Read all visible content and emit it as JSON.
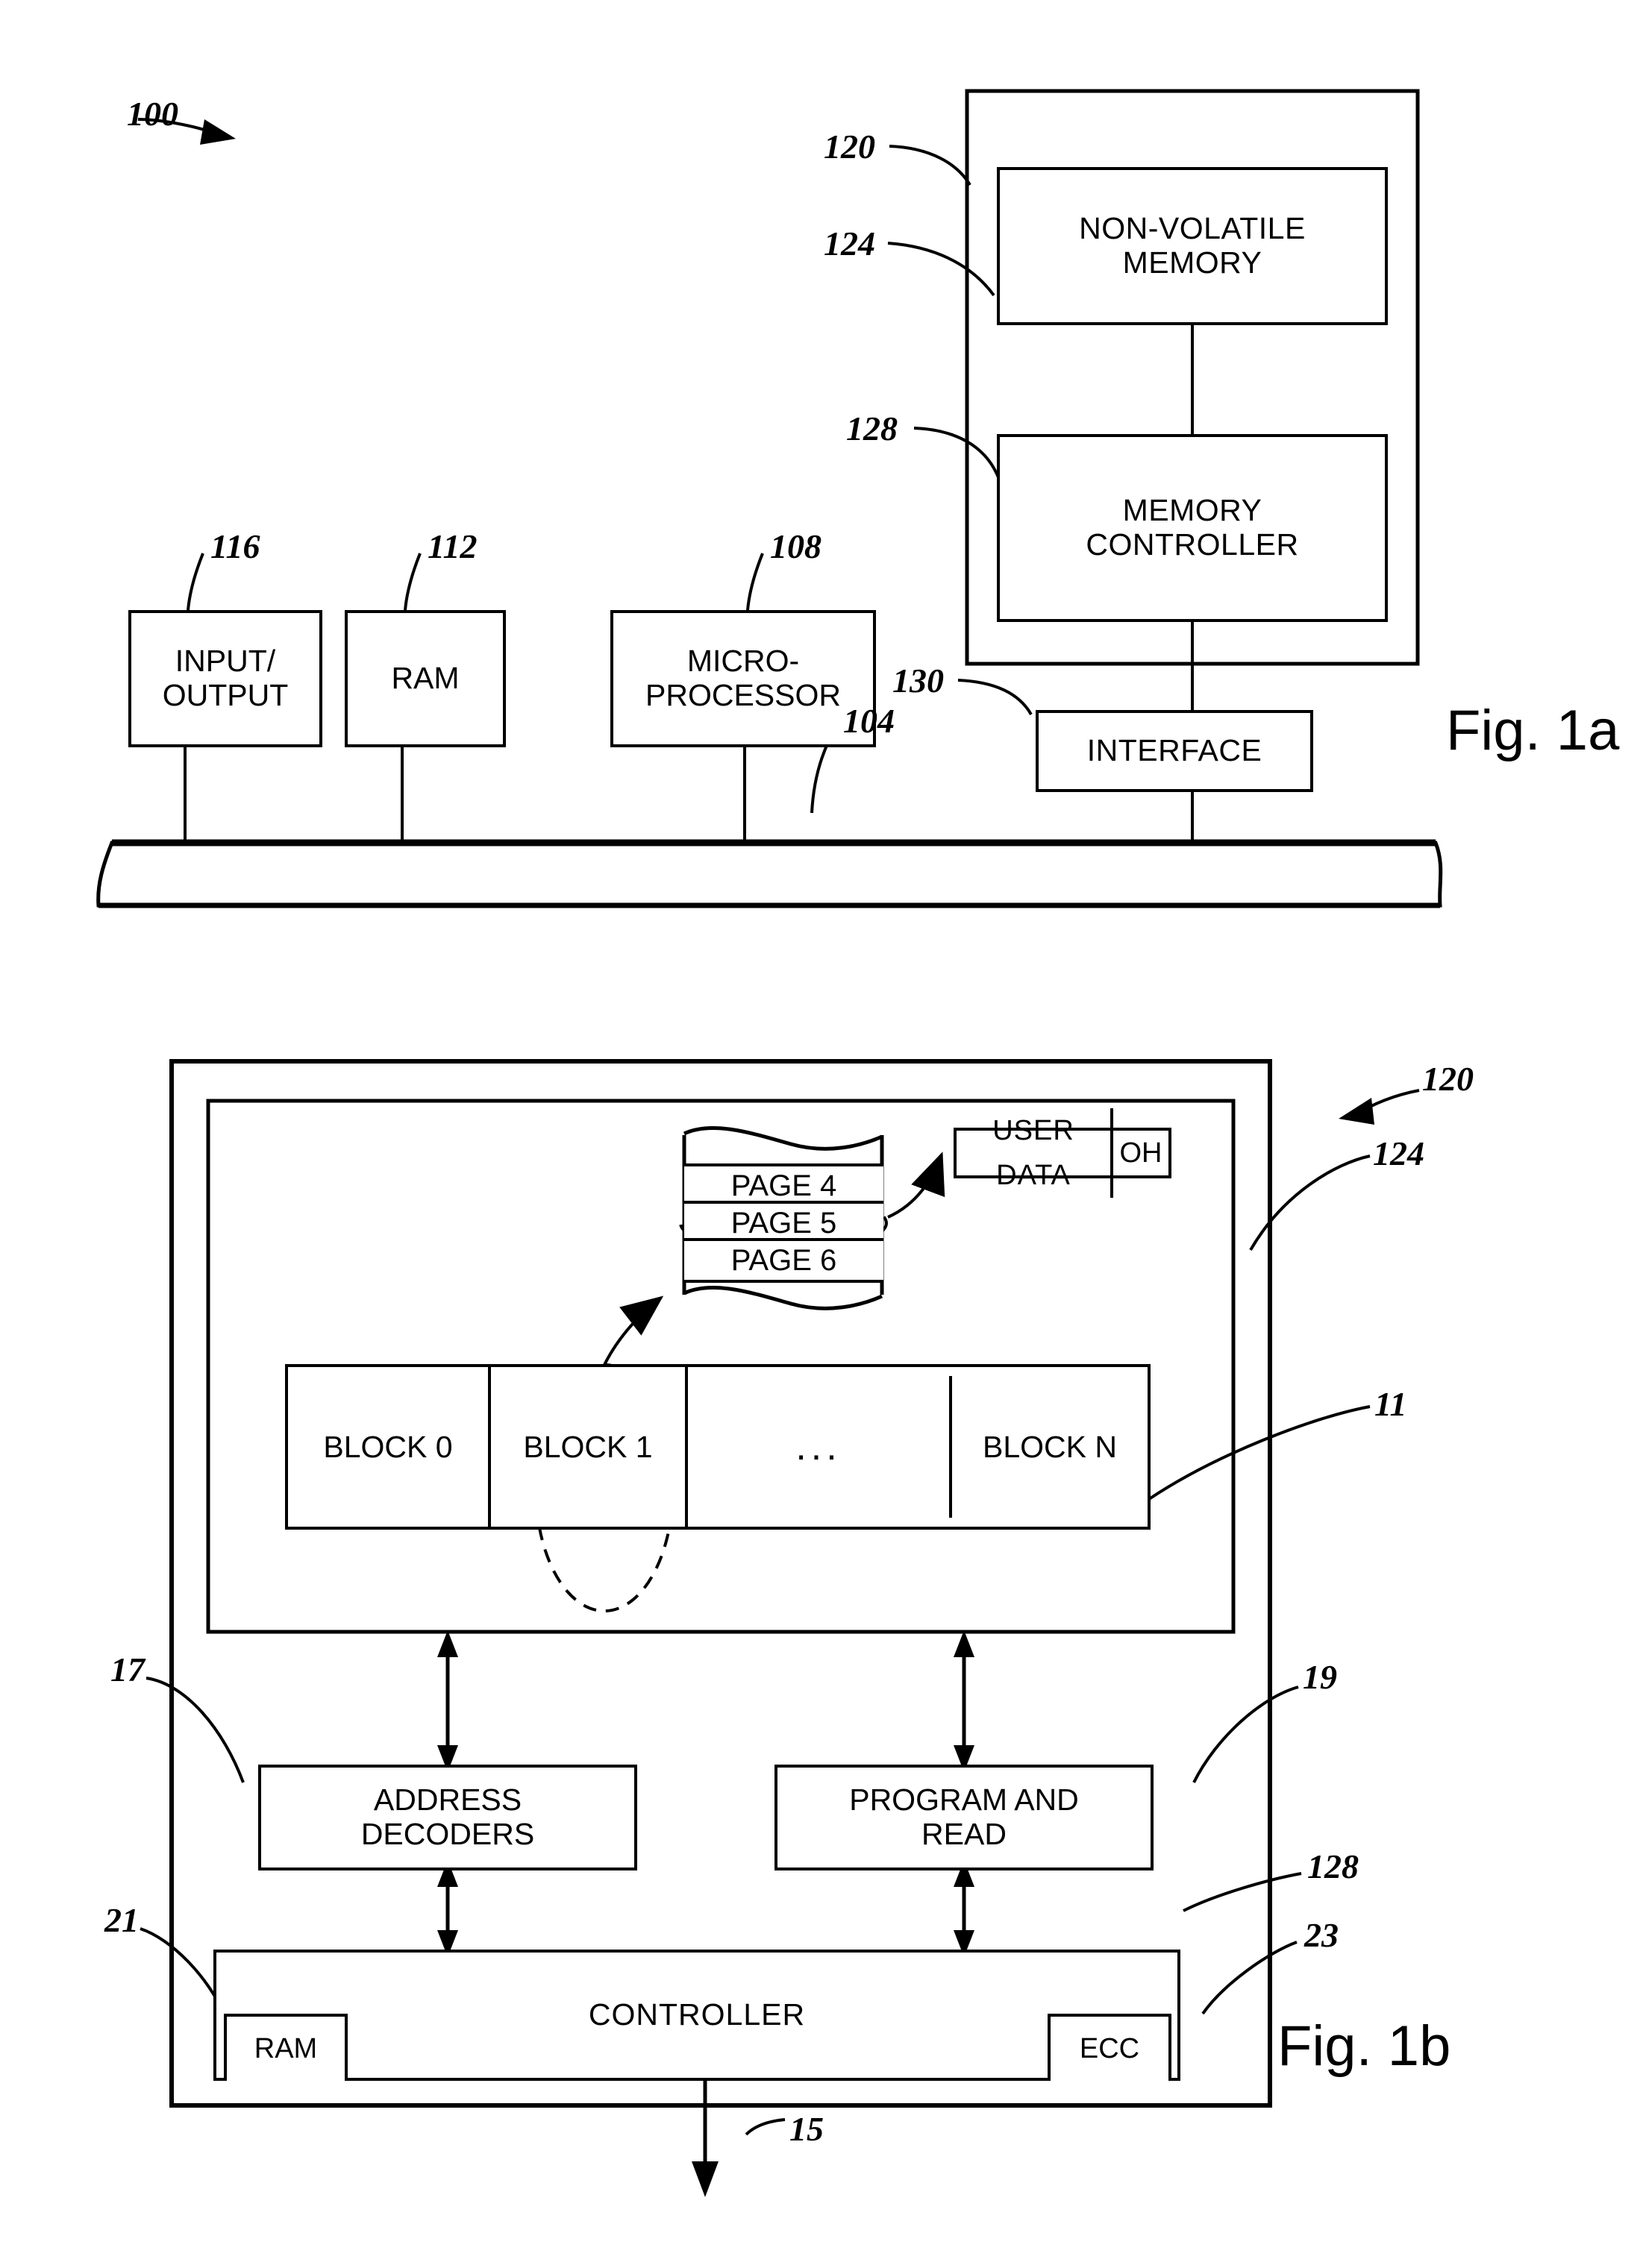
{
  "figures": [
    {
      "id": "fig-1a",
      "caption": "Fig. 1a",
      "system_ref": "100",
      "bus_ref": "104",
      "outer_module_ref": "120",
      "boxes": [
        {
          "name": "non-volatile-memory",
          "label": "NON-VOLATILE\nMEMORY",
          "ref": "124"
        },
        {
          "name": "memory-controller",
          "label": "MEMORY\nCONTROLLER",
          "ref": "128"
        },
        {
          "name": "interface",
          "label": "INTERFACE",
          "ref": "130"
        },
        {
          "name": "input-output",
          "label": "INPUT/\nOUTPUT",
          "ref": "116"
        },
        {
          "name": "ram",
          "label": "RAM",
          "ref": "112"
        },
        {
          "name": "microprocessor",
          "label": "MICRO-\nPROCESSOR",
          "ref": "108"
        }
      ]
    },
    {
      "id": "fig-1b",
      "caption": "Fig. 1b",
      "device_ref": "120",
      "array_ref": "124",
      "blocks_ref": "11",
      "address_decoders_ref": "17",
      "program_read_ref": "19",
      "controller_ref": "128",
      "controller_ram_ref": "21",
      "controller_ecc_ref": "23",
      "host_bus_ref": "15",
      "pages": [
        "PAGE 4",
        "PAGE 5",
        "PAGE 6"
      ],
      "page_detail": {
        "user_data": "USER  DATA",
        "overhead": "OH"
      },
      "blocks": [
        "BLOCK 0",
        "BLOCK 1",
        "...",
        "BLOCK N"
      ],
      "boxes": [
        {
          "name": "address-decoders",
          "label": "ADDRESS\nDECODERS"
        },
        {
          "name": "program-and-read",
          "label": "PROGRAM AND\nREAD"
        },
        {
          "name": "controller",
          "label": "CONTROLLER"
        },
        {
          "name": "controller-ram",
          "label": "RAM"
        },
        {
          "name": "controller-ecc",
          "label": "ECC"
        }
      ]
    }
  ],
  "fig1a": {
    "caption": "Fig. 1a",
    "ref_100": "100",
    "ref_104": "104",
    "ref_108": "108",
    "ref_112": "112",
    "ref_116": "116",
    "ref_120": "120",
    "ref_124": "124",
    "ref_128": "128",
    "ref_130": "130",
    "nvm_label": "NON-VOLATILE\nMEMORY",
    "memctrl_label": "MEMORY\nCONTROLLER",
    "interface_label": "INTERFACE",
    "io_label": "INPUT/\nOUTPUT",
    "ram_label": "RAM",
    "cpu_label": "MICRO-\nPROCESSOR"
  },
  "fig1b": {
    "caption": "Fig. 1b",
    "ref_120": "120",
    "ref_124": "124",
    "ref_11": "11",
    "ref_17": "17",
    "ref_19": "19",
    "ref_21": "21",
    "ref_23": "23",
    "ref_128": "128",
    "ref_15": "15",
    "page4": "PAGE 4",
    "page5": "PAGE 5",
    "page6": "PAGE 6",
    "user_data": "USER  DATA",
    "oh": "OH",
    "block0": "BLOCK 0",
    "block1": "BLOCK 1",
    "block_ellipsis": "...",
    "blockn": "BLOCK N",
    "address_decoders_label": "ADDRESS\nDECODERS",
    "program_read_label": "PROGRAM AND\nREAD",
    "controller_label": "CONTROLLER",
    "ram_label": "RAM",
    "ecc_label": "ECC"
  },
  "colors": {
    "ink": "#000000",
    "paper": "#ffffff"
  }
}
